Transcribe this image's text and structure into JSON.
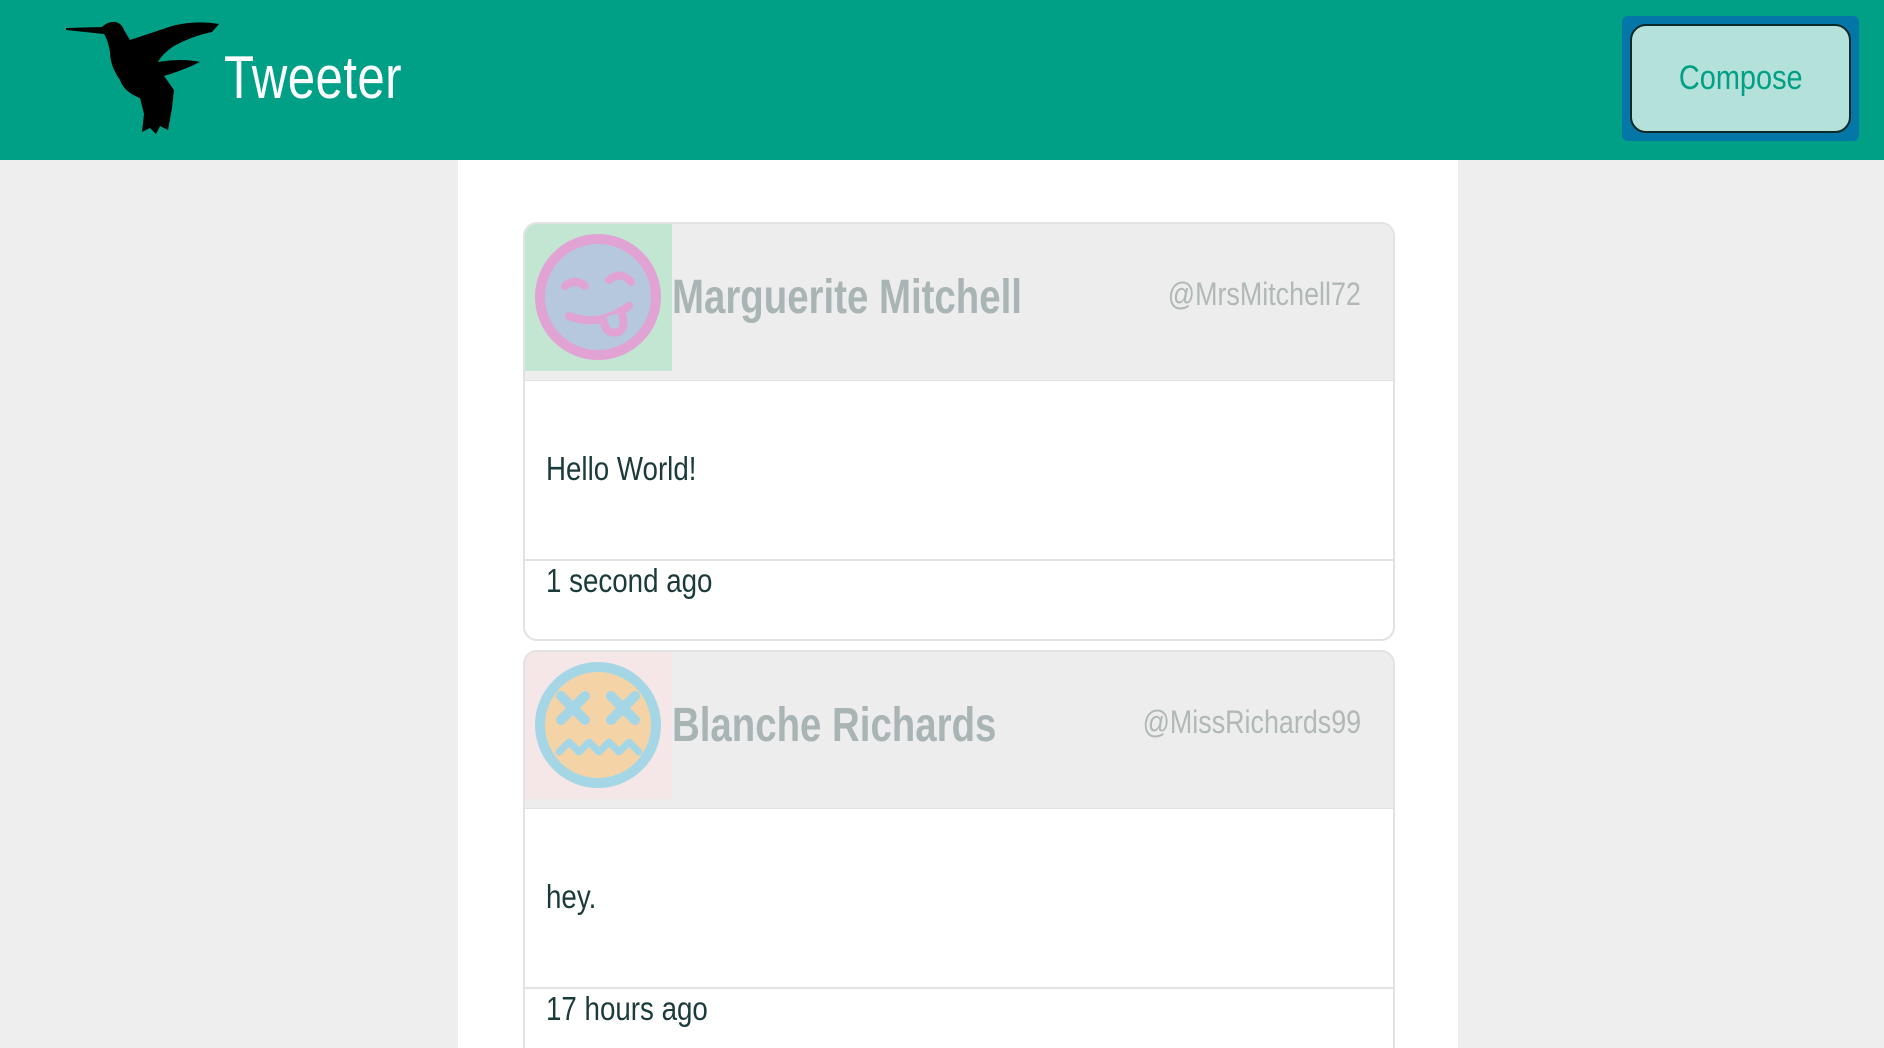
{
  "navbar": {
    "brand": "Tweeter",
    "logo_icon": "hummingbird-icon",
    "compose_label": "Compose"
  },
  "colors": {
    "navbar_bg": "#00a087",
    "compose_bg": "#b4e1d9",
    "compose_focus_ring": "#0576a8",
    "page_bg": "#eeeeee",
    "header_bg": "#ededed"
  },
  "tweets": [
    {
      "author": "Marguerite Mitchell",
      "handle": "@MrsMitchell72",
      "text": "Hello World!",
      "time": "1 second ago",
      "avatar_icon": "tongue-out-face-icon"
    },
    {
      "author": "Blanche Richards",
      "handle": "@MissRichards99",
      "text": "hey.",
      "time": "17 hours ago",
      "avatar_icon": "dizzy-face-icon"
    }
  ]
}
